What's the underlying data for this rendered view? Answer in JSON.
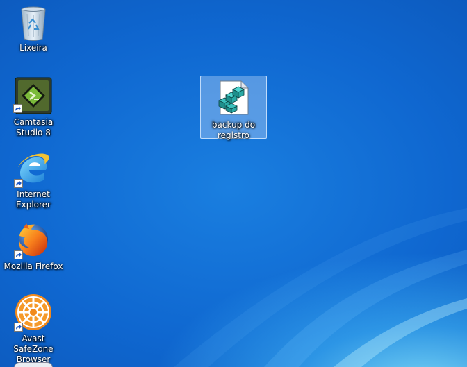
{
  "desktop": {
    "icons": [
      {
        "label": "Lixeira",
        "icon": "recycle-bin-icon",
        "shortcut": false
      },
      {
        "label": "Camtasia Studio 8",
        "icon": "camtasia-icon",
        "shortcut": true
      },
      {
        "label": "Internet Explorer",
        "icon": "internet-explorer-icon",
        "shortcut": true
      },
      {
        "label": "Mozilla Firefox",
        "icon": "firefox-icon",
        "shortcut": true
      },
      {
        "label": "Avast SafeZone Browser",
        "icon": "avast-safezone-icon",
        "shortcut": true
      },
      {
        "label": "backup do registro",
        "icon": "registry-file-icon",
        "shortcut": false,
        "selected": true
      }
    ]
  },
  "colors": {
    "background": "#0e5dc4",
    "selection": "#aacdf5",
    "label_text": "#ffffff"
  }
}
